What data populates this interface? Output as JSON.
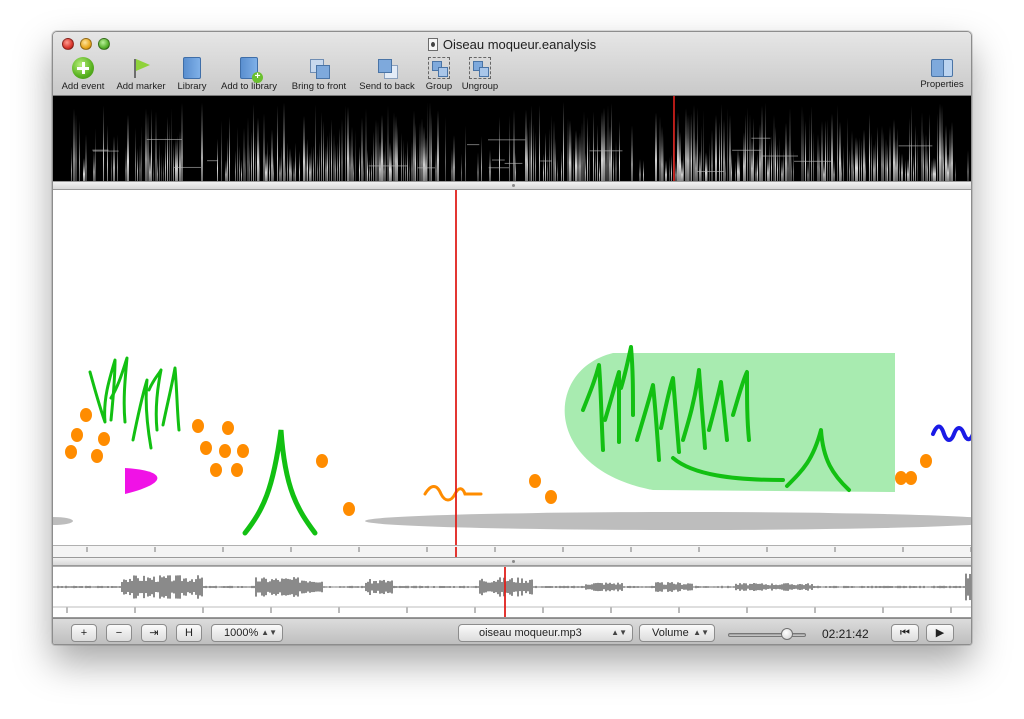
{
  "window": {
    "title": "Oiseau moqueur.eanalysis"
  },
  "toolbar": {
    "items": [
      {
        "label": "Add event",
        "icon": "add-event-icon"
      },
      {
        "label": "Add marker",
        "icon": "add-marker-icon"
      },
      {
        "label": "Library",
        "icon": "library-icon"
      },
      {
        "label": "Add to library",
        "icon": "add-to-library-icon"
      },
      {
        "label": "Bring to front",
        "icon": "bring-to-front-icon"
      },
      {
        "label": "Send to back",
        "icon": "send-to-back-icon"
      },
      {
        "label": "Group",
        "icon": "group-icon"
      },
      {
        "label": "Ungroup",
        "icon": "ungroup-icon"
      }
    ],
    "properties_label": "Properties"
  },
  "colors": {
    "playhead": "#e0201b",
    "event_green": "#12c012",
    "event_light_green": "#a8ebb0",
    "event_orange": "#ff8c00",
    "event_magenta": "#f012e6",
    "event_blue": "#1a1ae6",
    "event_grey": "#bdbdbd"
  },
  "bottom": {
    "plus_label": "+",
    "minus_label": "−",
    "fit_label": "⇥",
    "h_label": "H",
    "zoom": "1000%",
    "audio_file": "oiseau moqueur.mp3",
    "volume_label": "Volume",
    "volume_level": 0.75,
    "time": "02:21:42",
    "rewind_label": "⏮",
    "play_label": "▶"
  }
}
